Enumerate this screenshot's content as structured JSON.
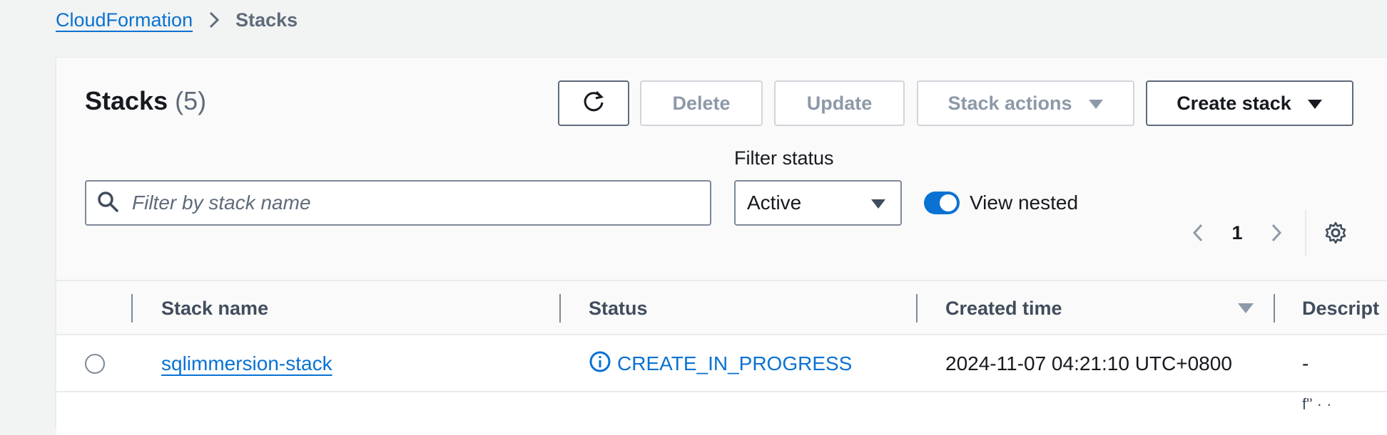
{
  "breadcrumb": {
    "root": "CloudFormation",
    "current": "Stacks"
  },
  "panel": {
    "title": "Stacks",
    "count": "(5)"
  },
  "toolbar": {
    "refresh_icon": "refresh-icon",
    "delete_label": "Delete",
    "update_label": "Update",
    "stack_actions_label": "Stack actions",
    "create_stack_label": "Create stack"
  },
  "filter": {
    "search_placeholder": "Filter by stack name",
    "search_value": "",
    "status_label": "Filter status",
    "status_value": "Active",
    "view_nested_label": "View nested",
    "view_nested_on": true
  },
  "pagination": {
    "current_page": "1"
  },
  "table": {
    "columns": [
      "Stack name",
      "Status",
      "Created time",
      "Descript"
    ],
    "rows": [
      {
        "stack_name": "sqlimmersion-stack",
        "status": "CREATE_IN_PROGRESS",
        "created_time": "2024-11-07 04:21:10 UTC+0800",
        "description": "-"
      }
    ],
    "next_row_peek": "f'' · ·"
  },
  "colors": {
    "link": "#0972d3",
    "toggle_on": "#0972d3",
    "disabled_text": "#8d99a8",
    "background": "#f2f3f3"
  }
}
